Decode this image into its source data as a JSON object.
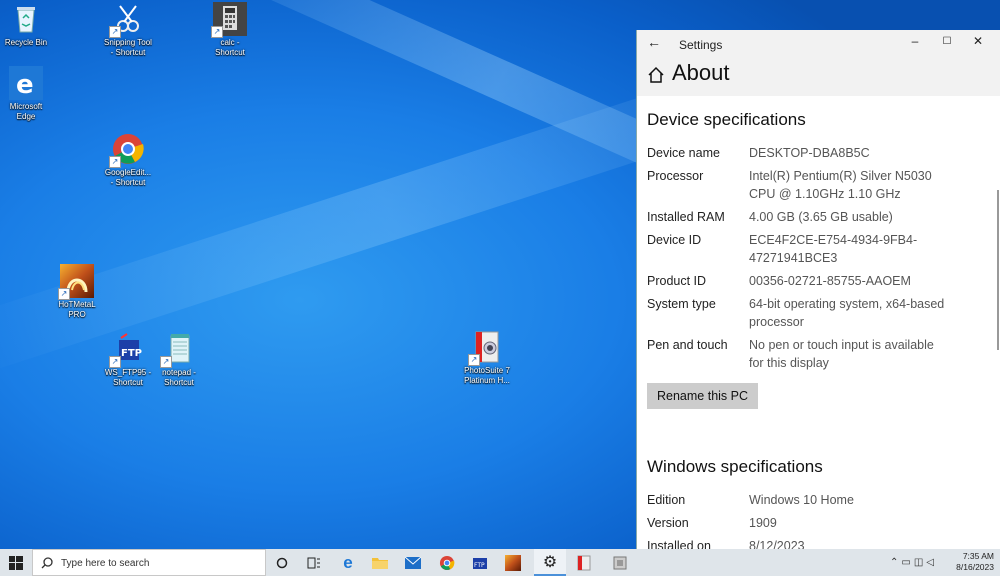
{
  "desktop": {
    "icons": {
      "recycle_bin": "Recycle Bin",
      "snipping": "Snipping Tool\n- Shortcut",
      "calc": "calc -\nShortcut",
      "edge": "Microsoft\nEdge",
      "chrome": "GoogleEdit...\n- Shortcut",
      "hotmetal": "HoTMetaL\nPRO",
      "wsftp": "WS_FTP95 -\nShortcut",
      "notepad": "notepad -\nShortcut",
      "photosuite": "PhotoSuite 7\nPlatinum H..."
    }
  },
  "settings": {
    "window_title": "Settings",
    "page_title": "About",
    "device_section": "Device specifications",
    "device_specs": [
      {
        "key": "Device name",
        "value": "DESKTOP-DBA8B5C"
      },
      {
        "key": "Processor",
        "value": "Intel(R) Pentium(R) Silver N5030 CPU @ 1.10GHz   1.10 GHz"
      },
      {
        "key": "Installed RAM",
        "value": "4.00 GB (3.65 GB usable)"
      },
      {
        "key": "Device ID",
        "value": "ECE4F2CE-E754-4934-9FB4-47271941BCE3"
      },
      {
        "key": "Product ID",
        "value": "00356-02721-85755-AAOEM"
      },
      {
        "key": "System type",
        "value": "64-bit operating system, x64-based processor"
      },
      {
        "key": "Pen and touch",
        "value": "No pen or touch input is available for this display"
      }
    ],
    "rename_button": "Rename this PC",
    "windows_section": "Windows specifications",
    "windows_specs": [
      {
        "key": "Edition",
        "value": "Windows 10 Home"
      },
      {
        "key": "Version",
        "value": "1909"
      },
      {
        "key": "Installed on",
        "value": "8/12/2023"
      }
    ]
  },
  "taskbar": {
    "search_placeholder": "Type here to search",
    "time": "7:35 AM",
    "date": "8/16/2023"
  }
}
